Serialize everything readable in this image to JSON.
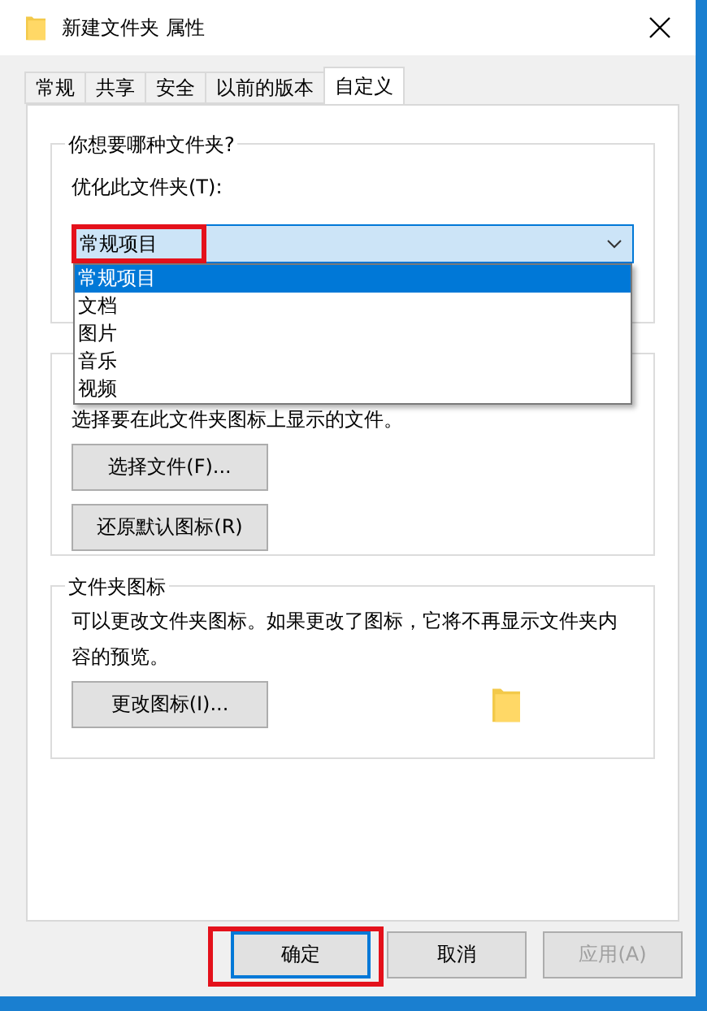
{
  "window": {
    "title": "新建文件夹 属性"
  },
  "tabs": [
    {
      "label": "常规",
      "selected": false
    },
    {
      "label": "共享",
      "selected": false
    },
    {
      "label": "安全",
      "selected": false
    },
    {
      "label": "以前的版本",
      "selected": false
    },
    {
      "label": "自定义",
      "selected": true
    }
  ],
  "folder_type": {
    "title": "你想要哪种文件夹?",
    "label": "优化此文件夹(T):",
    "value": "常规项目",
    "expanded": true,
    "highlighted": true,
    "options": [
      {
        "label": "常规项目",
        "selected": true
      },
      {
        "label": "文档",
        "selected": false
      },
      {
        "label": "图片",
        "selected": false
      },
      {
        "label": "音乐",
        "selected": false
      },
      {
        "label": "视频",
        "selected": false
      }
    ]
  },
  "folder_pictures": {
    "description": "选择要在此文件夹图标上显示的文件。",
    "buttons": [
      "选择文件(F)...",
      "还原默认图标(R)"
    ]
  },
  "folder_icons": {
    "title": "文件夹图标",
    "description": "可以更改文件夹图标。如果更改了图标，它将不再显示文件夹内容的预览。",
    "button": "更改图标(I)..."
  },
  "buttons": [
    {
      "label": "确定",
      "default": true,
      "highlighted": true,
      "disabled": false
    },
    {
      "label": "取消",
      "default": false,
      "highlighted": false,
      "disabled": false
    },
    {
      "label": "应用(A)",
      "default": false,
      "highlighted": false,
      "disabled": true
    }
  ]
}
